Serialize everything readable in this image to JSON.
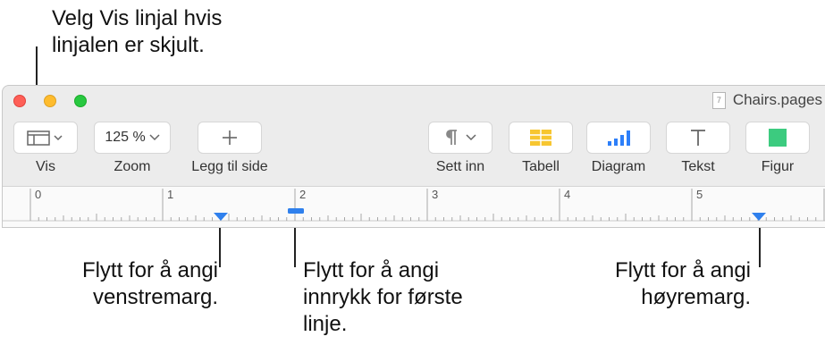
{
  "callouts": {
    "vis_hint": "Velg Vis linjal hvis\nlinjalen er skjult.",
    "left_margin": "Flytt for å angi\nvenstremarg.",
    "first_line_indent": "Flytt for å angi\ninnrykk for første\nlinje.",
    "right_margin": "Flytt for å angi\nhøyremarg."
  },
  "window": {
    "doc_icon": "document-icon",
    "doc_icon_glyph": "7",
    "doc_title": "Chairs.pages"
  },
  "toolbar": {
    "vis_label": "Vis",
    "zoom_value": "125 %",
    "zoom_label": "Zoom",
    "add_page_label": "Legg til side",
    "insert_label": "Sett inn",
    "table_label": "Tabell",
    "chart_label": "Diagram",
    "text_label": "Tekst",
    "shape_label": "Figur"
  },
  "ruler": {
    "numbers": [
      "0",
      "1",
      "2",
      "3",
      "4",
      "5"
    ]
  },
  "colors": {
    "close": "#fe5f57",
    "minimize": "#febc2e",
    "zoom": "#28c840",
    "table_yellow": "#f7c630",
    "chart_blue": "#2d7ff9",
    "shape_green": "#3ccb7f",
    "marker_blue": "#2f80ed"
  }
}
